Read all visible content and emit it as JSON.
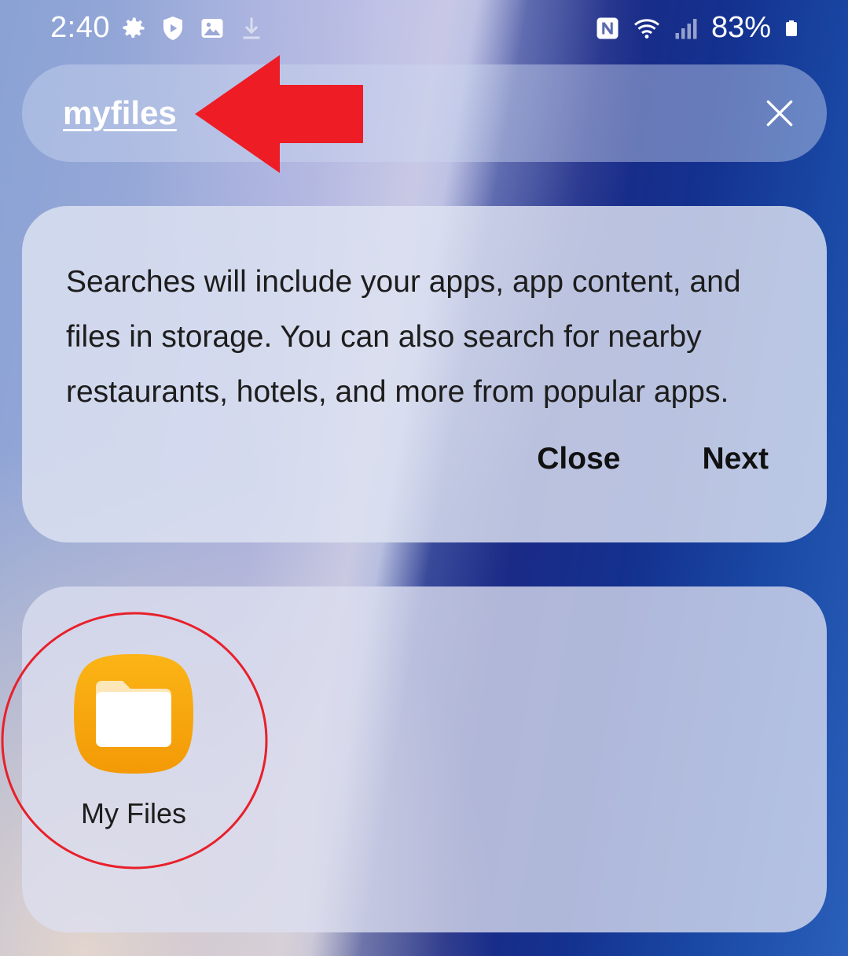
{
  "status_bar": {
    "time": "2:40",
    "battery": "83%",
    "left_icons": [
      "gear-icon",
      "shield-play-icon",
      "gallery-icon",
      "download-icon"
    ],
    "right_icons": [
      "nfc-icon",
      "wifi-icon",
      "signal-icon",
      "battery-icon"
    ]
  },
  "search": {
    "query": "myfiles",
    "clear_icon": "close-icon"
  },
  "info_card": {
    "message": "Searches will include your apps, app content, and files in storage. You can also search for nearby restaurants, hotels, and more from popular apps.",
    "close_label": "Close",
    "next_label": "Next"
  },
  "results": {
    "apps": [
      {
        "label": "My Files",
        "icon": "folder-icon"
      }
    ]
  },
  "colors": {
    "annotation_red": "#e8202a",
    "folder_orange": "#f6a10a",
    "status_text": "#ffffff"
  }
}
